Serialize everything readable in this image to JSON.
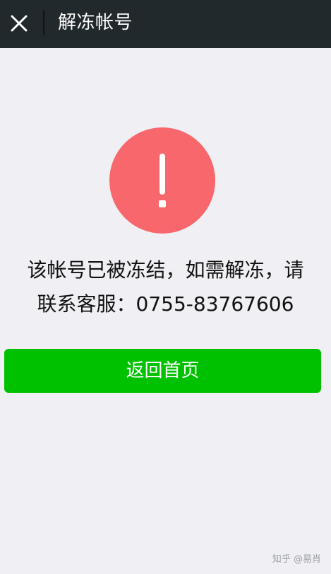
{
  "header": {
    "title": "解冻帐号",
    "close_icon": "close-icon"
  },
  "alert": {
    "icon": "exclamation-icon",
    "color": "#f8676b"
  },
  "message": {
    "line1": "该帐号已被冻结，如需解冻，请",
    "line2": "联系客服：0755-83767606"
  },
  "action": {
    "button_label": "返回首页",
    "button_color": "#00c100"
  },
  "watermark": {
    "text": "知乎 @易肖"
  }
}
